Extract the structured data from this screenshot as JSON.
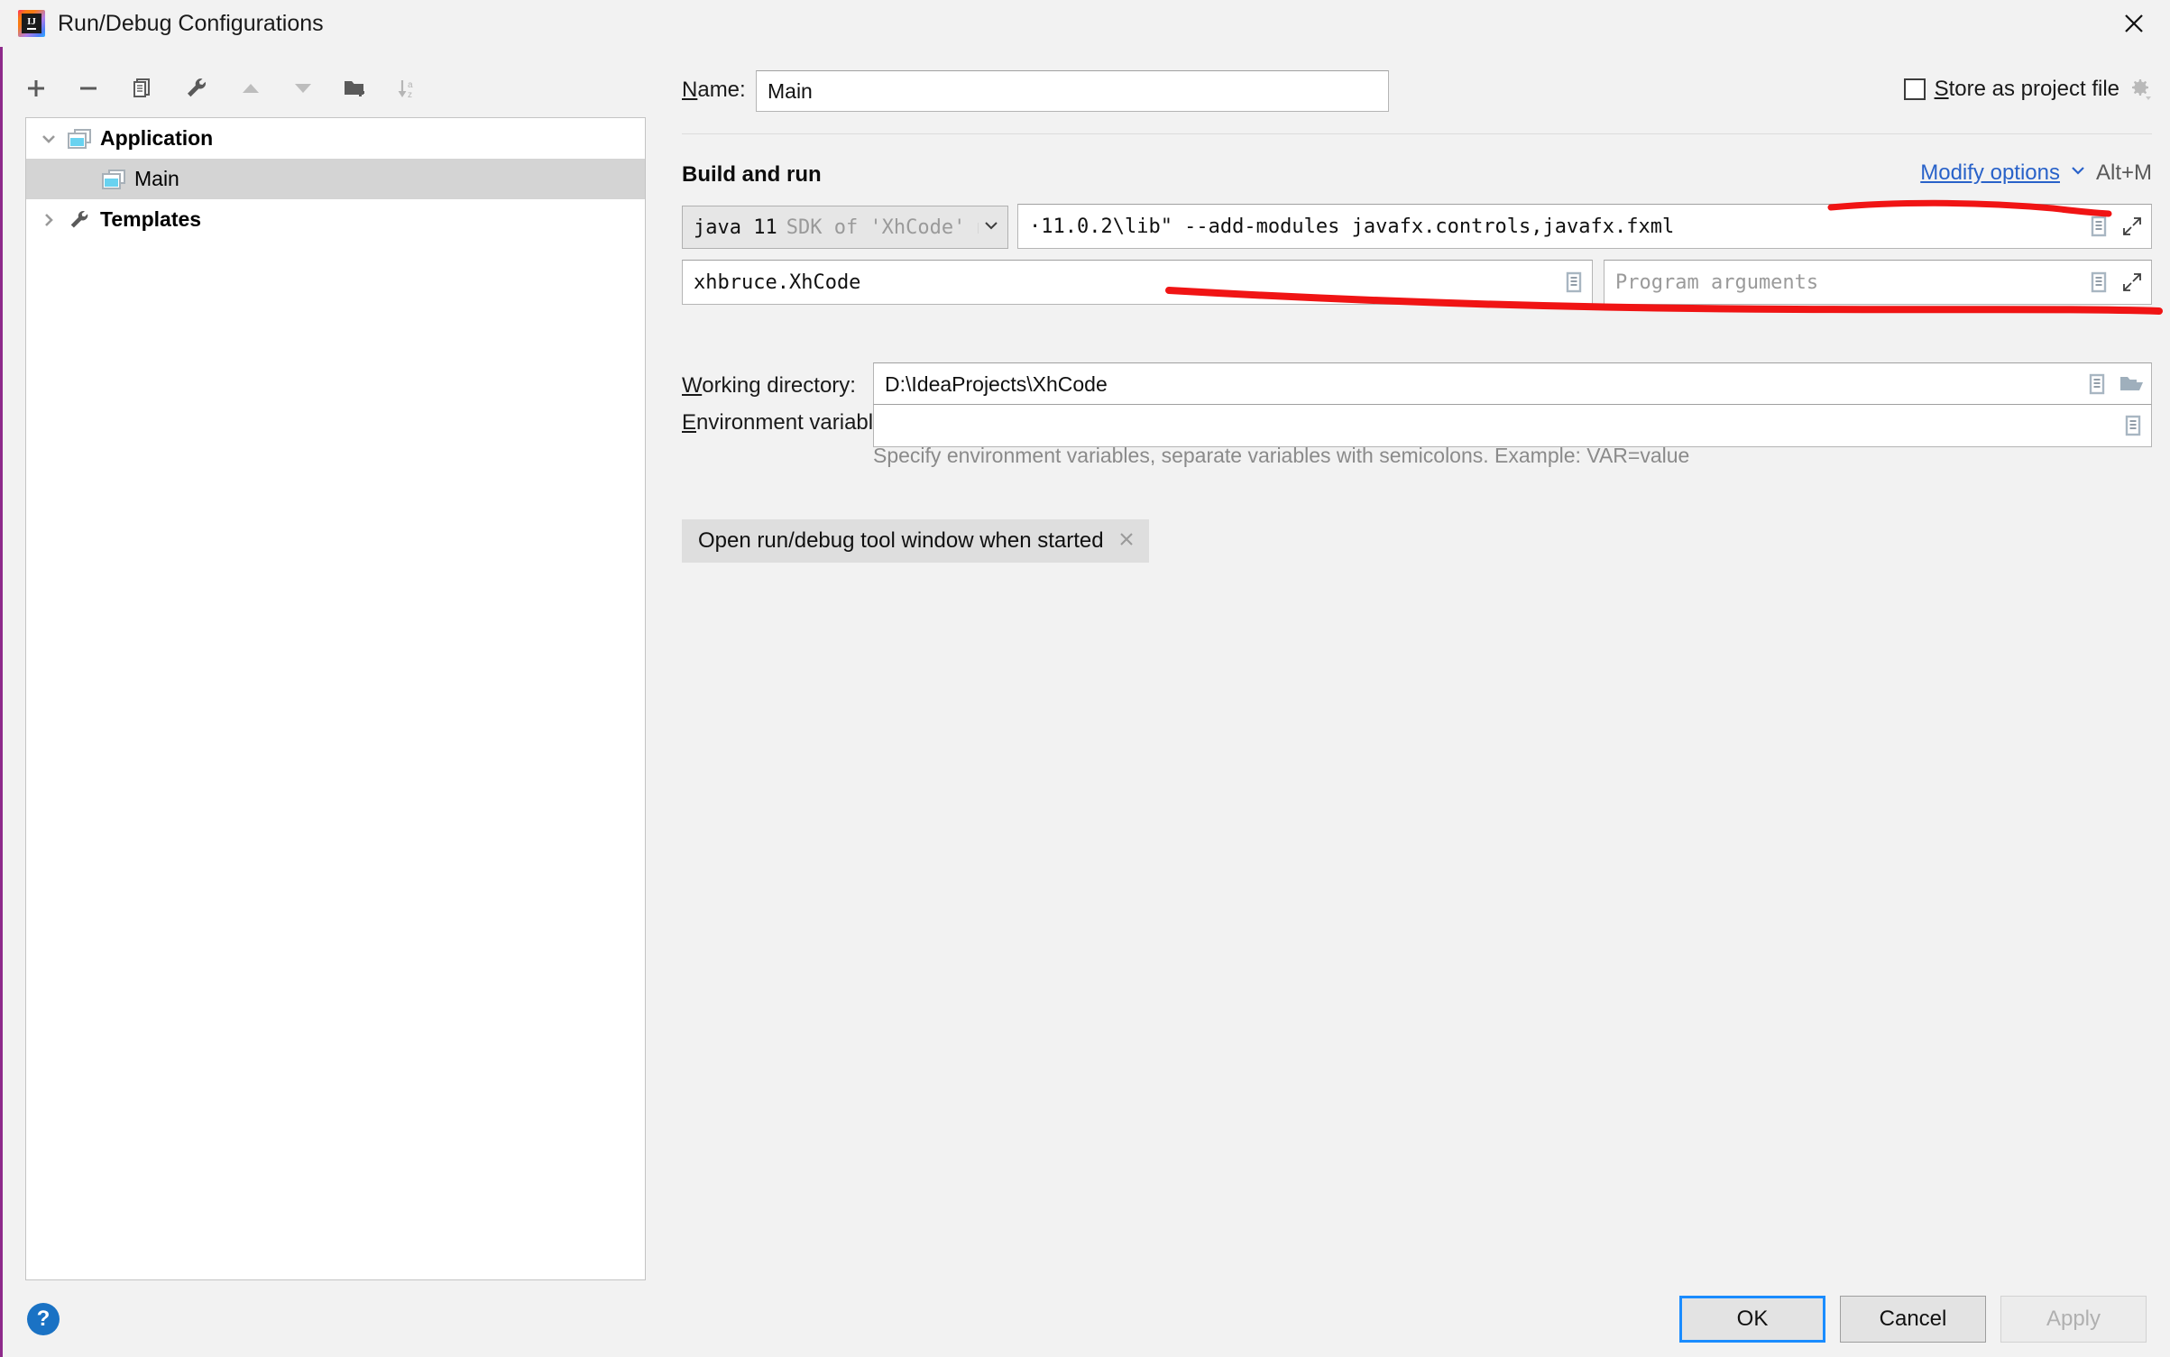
{
  "window": {
    "title": "Run/Debug Configurations",
    "logo_icon": "intellij-idea-logo",
    "close_icon": "close-icon"
  },
  "toolbar": {
    "buttons": [
      {
        "name": "add",
        "icon": "plus-icon",
        "enabled": true
      },
      {
        "name": "remove",
        "icon": "minus-icon",
        "enabled": true
      },
      {
        "name": "copy",
        "icon": "copy-icon",
        "enabled": true
      },
      {
        "name": "edit-templates",
        "icon": "wrench-icon",
        "enabled": true
      },
      {
        "name": "move-up",
        "icon": "arrow-up-icon",
        "enabled": false
      },
      {
        "name": "move-down",
        "icon": "arrow-down-icon",
        "enabled": false
      },
      {
        "name": "new-folder",
        "icon": "folder-add-icon",
        "enabled": true
      },
      {
        "name": "sort-alphabetically",
        "icon": "sort-az-icon",
        "enabled": false
      }
    ]
  },
  "tree": {
    "nodes": [
      {
        "label": "Application",
        "icon": "application-icon",
        "arrow": "chevron-down-icon",
        "bold": true,
        "selected": false,
        "child": false
      },
      {
        "label": "Main",
        "icon": "application-icon",
        "arrow": "",
        "bold": false,
        "selected": true,
        "child": true
      },
      {
        "label": "Templates",
        "icon": "wrench-icon",
        "arrow": "chevron-right-icon",
        "bold": true,
        "selected": false,
        "child": false
      }
    ]
  },
  "form": {
    "name_label": "Name:",
    "name_label_mnemonic": "N",
    "name_value": "Main",
    "store_as_project_file_label": "Store as project file",
    "store_as_project_file_mnemonic": "S",
    "store_as_project_file_checked": false,
    "store_gear_icon": "gear-dropdown-icon",
    "section_title": "Build and run",
    "modify_options_label": "Modify options",
    "modify_options_shortcut": "Alt+M",
    "modify_options_chevron": "chevron-down-icon",
    "jre_main": "java 11",
    "jre_sub": "SDK of 'XhCode' mod",
    "jre_chevron": "chevron-down-icon",
    "vm_options_value": "·11.0.2\\lib\" --add-modules javafx.controls,javafx.fxml",
    "vm_options_macro_icon": "macro-list-icon",
    "vm_options_expand_icon": "expand-icon",
    "main_class_value": "xhbruce.XhCode",
    "main_class_macro_icon": "macro-list-icon",
    "program_arguments_placeholder": "Program arguments",
    "program_arguments_value": "",
    "program_arguments_macro_icon": "macro-list-icon",
    "program_arguments_expand_icon": "expand-icon",
    "working_directory_label": "Working directory:",
    "working_directory_mnemonic": "W",
    "working_directory_value": "D:\\IdeaProjects\\XhCode",
    "working_directory_macro_icon": "macro-list-icon",
    "working_directory_browse_icon": "folder-open-icon",
    "environment_variables_label": "Environment variables:",
    "environment_variables_mnemonic": "E",
    "environment_variables_value": "",
    "environment_variables_macro_icon": "macro-list-icon",
    "environment_hint": "Specify environment variables, separate variables with semicolons. Example: VAR=value",
    "chip_label": "Open run/debug tool window when started",
    "chip_close_icon": "close-small-icon"
  },
  "footer": {
    "help_icon": "help-question-icon",
    "ok_label": "OK",
    "cancel_label": "Cancel",
    "apply_label": "Apply",
    "apply_enabled": false
  },
  "annotations": {
    "color": "#f01414",
    "marks": [
      {
        "name": "underline-modify-options"
      },
      {
        "name": "underline-vm-options"
      }
    ]
  },
  "colors": {
    "accent_blue": "#2962c9",
    "focus_blue": "#1a8cff",
    "annotation_red": "#f01414",
    "selection_gray": "#d4d4d4",
    "window_bg": "#f2f2f2"
  }
}
